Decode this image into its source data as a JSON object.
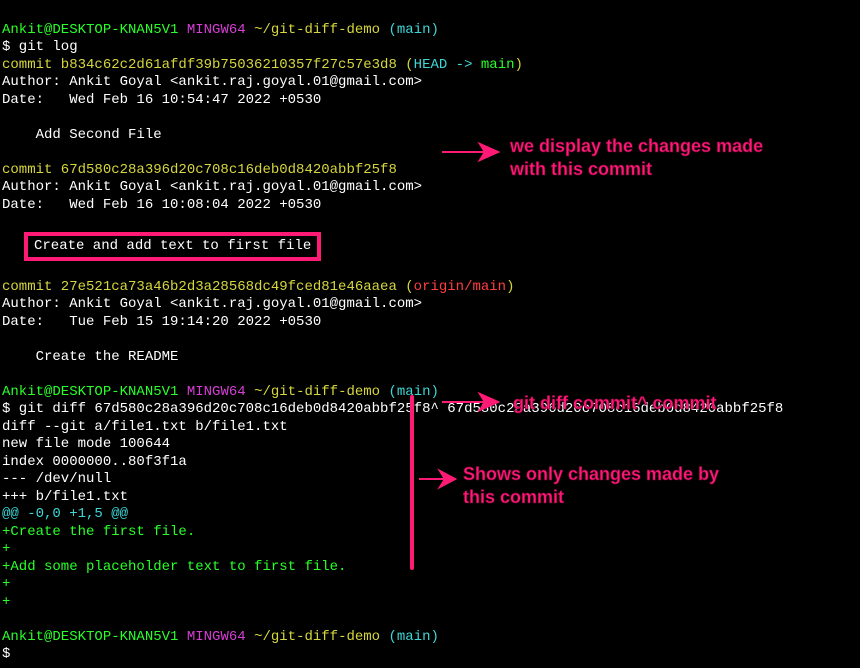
{
  "prompt1": {
    "user": "Ankit@DESKTOP-KNAN5V1",
    "env": "MINGW64",
    "path": "~/git-diff-demo",
    "branch": "(main)"
  },
  "cmd1": "$ git log",
  "log": {
    "c1": {
      "line": "commit b834c62c2d61afdf39b75036210357f27c57e3d8 (",
      "head": "HEAD -> ",
      "branch": "main",
      "close": ")",
      "author": "Author: Ankit Goyal <ankit.raj.goyal.01@gmail.com>",
      "date": "Date:   Wed Feb 16 10:54:47 2022 +0530",
      "msg": "    Add Second File"
    },
    "c2": {
      "line": "commit 67d580c28a396d20c708c16deb0d8420abbf25f8",
      "author": "Author: Ankit Goyal <ankit.raj.goyal.01@gmail.com>",
      "date": "Date:   Wed Feb 16 10:08:04 2022 +0530",
      "msg": "Create and add text to first file"
    },
    "c3": {
      "line": "commit 27e521ca73a46b2d3a28568dc49fced81e46aaea (",
      "ref": "origin/main",
      "close": ")",
      "author": "Author: Ankit Goyal <ankit.raj.goyal.01@gmail.com>",
      "date": "Date:   Tue Feb 15 19:14:20 2022 +0530",
      "msg": "    Create the README"
    }
  },
  "cmd2": "$ git diff 67d580c28a396d20c708c16deb0d8420abbf25f8^ 67d580c28a396d20c708c16deb0d8420abbf25f8",
  "diff": {
    "header": "diff --git a/file1.txt b/file1.txt",
    "mode": "new file mode 100644",
    "index": "index 0000000..80f3f1a",
    "old": "--- /dev/null",
    "new": "+++ b/file1.txt",
    "hunk": "@@ -0,0 +1,5 @@",
    "l1": "+Create the first file.",
    "l2": "+",
    "l3": "+Add some placeholder text to first file.",
    "l4": "+",
    "l5": "+"
  },
  "prompt3": "$ ",
  "annotations": {
    "a1": "we display the changes made with this commit",
    "a2": "git diff commit^ commit",
    "a3": "Shows only changes made by this commit"
  }
}
